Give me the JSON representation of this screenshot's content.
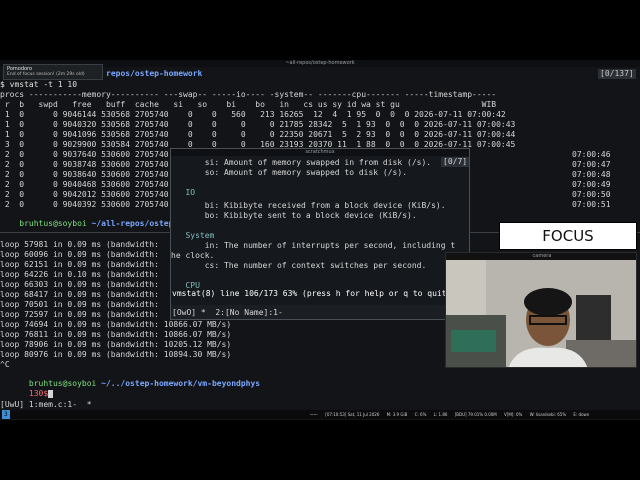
{
  "window_title": "~all-repos/ostep-homework",
  "counter": "[0/137]",
  "pomodoro": {
    "title": "Pomodoro",
    "body": "End of focus session! (2m 29s old)"
  },
  "top_prompt_tail": "repos/ostep-homework",
  "command": "$ vmstat -t 1 10",
  "vmstat_header1": "procs -----------memory---------- ---swap-- -----io---- -system-- -------cpu------- -----timestamp-----",
  "vmstat_header2": " r  b   swpd   free   buff  cache   si   so    bi    bo   in   cs us sy id wa st gu                 WIB",
  "vmstat_rows": [
    " 1  0      0 9046144 530568 2705740    0    0   560   213 16265  12  4  1 95  0  0  0 2026-07-11 07:00:42",
    " 1  0      0 9040320 530568 2705740    0    0     0     0 21785 28342  5  1 93  0  0  0 2026-07-11 07:00:43",
    " 1  0      0 9041096 530568 2705740    0    0     0     0 22350 20671  5  2 93  0  0  0 2026-07-11 07:00:44",
    " 3  0      0 9029900 530584 2705740    0    0     0   160 23193 20370 11  1 88  0  0  0 2026-07-11 07:00:45",
    " 2  0      0 9037640 530600 2705740",
    " 2  0      0 9038748 530600 2705740",
    " 2  0      0 9038640 530600 2705740",
    " 2  0      0 9040468 530600 2705740",
    " 2  0      0 9042012 530600 2705740",
    " 2  0      0 9040392 530600 2705740"
  ],
  "vmstat_timestamps_right": [
    "07:00:46",
    "07:00:47",
    "07:00:48",
    "07:00:49",
    "07:00:50",
    "07:00:51"
  ],
  "prompt1": {
    "user": "bruhtus",
    "host": "@soyboi",
    "path": " ~/all-repos/ostep-h"
  },
  "loop_lines": [
    "loop 57981 in 0.09 ms (bandwidth:",
    "loop 60096 in 0.09 ms (bandwidth:",
    "loop 62151 in 0.09 ms (bandwidth:",
    "loop 64226 in 0.10 ms (bandwidth:",
    "loop 66303 in 0.09 ms (bandwidth:",
    "loop 68417 in 0.09 ms (bandwidth:",
    "loop 70501 in 0.09 ms (bandwidth:",
    "loop 72597 in 0.09 ms (bandwidth:",
    "loop 74694 in 0.09 ms (bandwidth: 10866.07 MB/s)",
    "loop 76811 in 0.09 ms (bandwidth: 10866.07 MB/s)",
    "loop 78906 in 0.09 ms (bandwidth: 10205.12 MB/s)",
    "loop 80976 in 0.09 ms (bandwidth: 10894.30 MB/s)"
  ],
  "ctrl_c": "^C",
  "prompt2": {
    "user": "bruhtus",
    "host": "@soyboi",
    "path": " ~/../ostep-homework/vm-beyondphys"
  },
  "exit_code": "130$",
  "tmux_status": "[UwU] 1:mem.c:1-  *",
  "popup": {
    "title": "scratchmux",
    "counter": "[0/7]",
    "lines": [
      "       si: Amount of memory swapped in from disk (/s).",
      "       so: Amount of memory swapped to disk (/s).",
      "",
      "   IO",
      "       bi: Kibibyte received from a block device (KiB/s).",
      "       bo: Kibibyte sent to a block device (KiB/s).",
      "",
      "   System",
      "       in: The number of interrupts per second, including t",
      "he clock.",
      "       cs: The number of context switches per second.",
      "",
      "   CPU"
    ],
    "status_line": "vmstat(8) line 106/173 63% (press h for help or q to quit)",
    "tmux_bar": "[OwO] *  2:[No Name]:1-"
  },
  "focus_label": "FOCUS",
  "camera_title": "camera",
  "bottom_bar": {
    "workspace": "3",
    "segments": [
      "~~·",
      "[07:10:53] Sat, 11 Jul 2026",
      "M: 3.9 GiB",
      "C: 6%",
      "L: 1.86",
      "[BDU] 79.01% 0.00M",
      "V[M]: 0%",
      "W: lisanikebi: 65%",
      "E: down"
    ]
  }
}
